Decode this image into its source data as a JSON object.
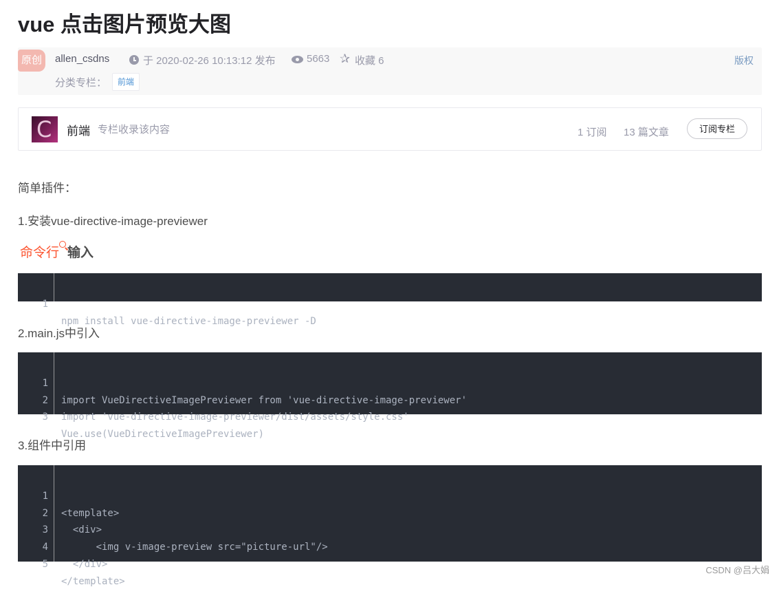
{
  "article": {
    "title": "vue 点击图片预览大图"
  },
  "meta": {
    "original_badge": "原创",
    "author": "allen_csdns",
    "publish_time": "于 2020-02-26 10:13:12 发布",
    "views": "5663",
    "collect": "收藏 6",
    "copyright": "版权",
    "category_label": "分类专栏：",
    "category_tag": "前端"
  },
  "column": {
    "name": "前端",
    "desc": "专栏收录该内容",
    "subscribers": "1 订阅",
    "articles": "13 篇文章",
    "subscribe_button": "订阅专栏"
  },
  "content": {
    "intro": "简单插件：",
    "step1": "1.安装vue-directive-image-previewer",
    "cmd_link": "命令行",
    "cmd_suffix": "输入",
    "step2": "2.main.js中引入",
    "step3": "3.组件中引用"
  },
  "code_blocks": [
    {
      "lines": [
        {
          "num": "1",
          "text": "npm install vue-directive-image-previewer -D"
        }
      ]
    },
    {
      "lines": [
        {
          "num": "1",
          "text": "import VueDirectiveImagePreviewer from 'vue-directive-image-previewer'"
        },
        {
          "num": "2",
          "text": "import 'vue-directive-image-previewer/dist/assets/style.css'"
        },
        {
          "num": "3",
          "text": "Vue.use(VueDirectiveImagePreviewer)"
        }
      ]
    },
    {
      "lines": [
        {
          "num": "1",
          "text": "<template>"
        },
        {
          "num": "2",
          "text": "  <div>"
        },
        {
          "num": "3",
          "text": "      <img v-image-preview src=\"picture-url\"/>"
        },
        {
          "num": "4",
          "text": "  </div>"
        },
        {
          "num": "5",
          "text": "</template>"
        }
      ]
    }
  ],
  "watermark": "CSDN @吕大娟"
}
